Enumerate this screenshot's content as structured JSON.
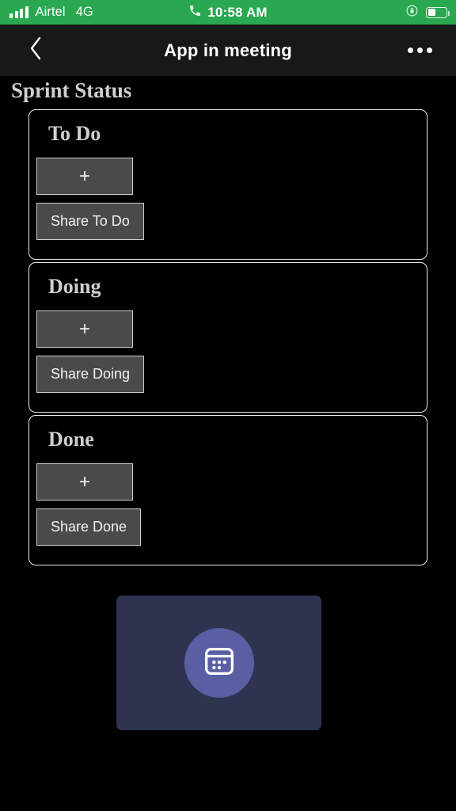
{
  "status_bar": {
    "carrier": "Airtel",
    "network_type": "4G",
    "time": "10:58 AM",
    "call_icon": "phone-handset-icon",
    "signal_icon": "signal-bars-icon",
    "rotation_lock_icon": "rotation-lock-icon",
    "battery_icon": "battery-icon",
    "background_color": "#2aa84f"
  },
  "header": {
    "title": "App in meeting",
    "back_icon": "chevron-left-icon",
    "more_icon": "more-horizontal-icon"
  },
  "page": {
    "title": "Sprint Status"
  },
  "columns": [
    {
      "title": "To Do",
      "add_label": "+",
      "share_label": "Share To Do"
    },
    {
      "title": "Doing",
      "add_label": "+",
      "share_label": "Share Doing"
    },
    {
      "title": "Done",
      "add_label": "+",
      "share_label": "Share Done"
    }
  ],
  "app_tile": {
    "icon": "calendar-grid-icon",
    "tile_color": "#2e3350",
    "circle_color": "#5a5fa3"
  }
}
